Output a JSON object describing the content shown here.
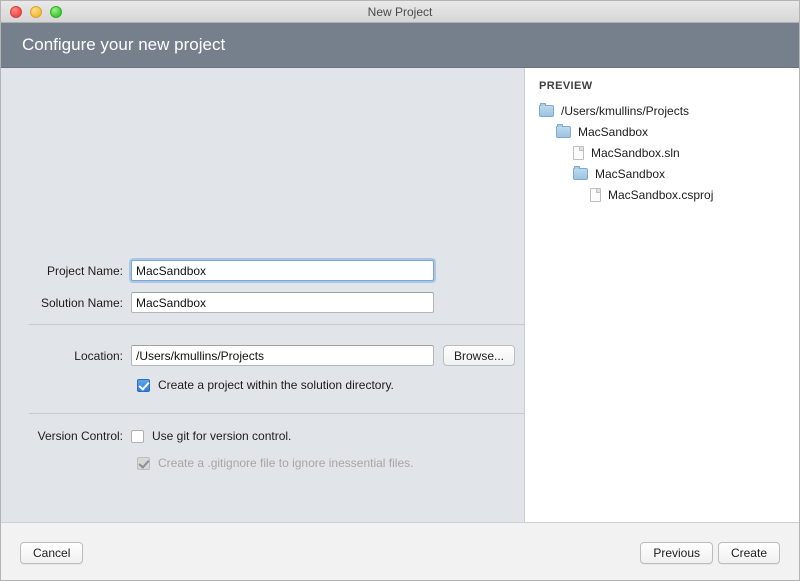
{
  "window": {
    "title": "New Project"
  },
  "traffic_lights": {
    "close": "close-button",
    "minimize": "minimize-button",
    "maximize": "maximize-button"
  },
  "header": {
    "title": "Configure your new project"
  },
  "form": {
    "project_name": {
      "label": "Project Name:",
      "value": "MacSandbox",
      "focused": true
    },
    "solution_name": {
      "label": "Solution Name:",
      "value": "MacSandbox",
      "focused": false
    },
    "location": {
      "label": "Location:",
      "value": "/Users/kmullins/Projects",
      "browse_label": "Browse..."
    },
    "create_project_in_solution_dir": {
      "label": "Create a project within the solution directory.",
      "checked": true,
      "enabled": true
    },
    "version_control": {
      "label": "Version Control:",
      "use_git": {
        "label": "Use git for version control.",
        "checked": false,
        "enabled": true
      },
      "create_gitignore": {
        "label": "Create a .gitignore file to ignore inessential files.",
        "checked": true,
        "enabled": false
      }
    }
  },
  "preview": {
    "title": "PREVIEW",
    "tree": [
      {
        "label": "/Users/kmullins/Projects",
        "icon": "folder-icon",
        "depth": 0
      },
      {
        "label": "MacSandbox",
        "icon": "folder-icon",
        "depth": 1
      },
      {
        "label": "MacSandbox.sln",
        "icon": "file-icon",
        "depth": 2
      },
      {
        "label": "MacSandbox",
        "icon": "folder-icon",
        "depth": 2
      },
      {
        "label": "MacSandbox.csproj",
        "icon": "file-icon",
        "depth": 3
      }
    ]
  },
  "footer": {
    "cancel_label": "Cancel",
    "previous_label": "Previous",
    "create_label": "Create"
  },
  "colors": {
    "header_band": "#76808c",
    "form_background": "#e1e4e8",
    "preview_background": "#ffffff",
    "checkbox_accent": "#2f7fd8",
    "folder_icon": "#9cc3e3"
  }
}
